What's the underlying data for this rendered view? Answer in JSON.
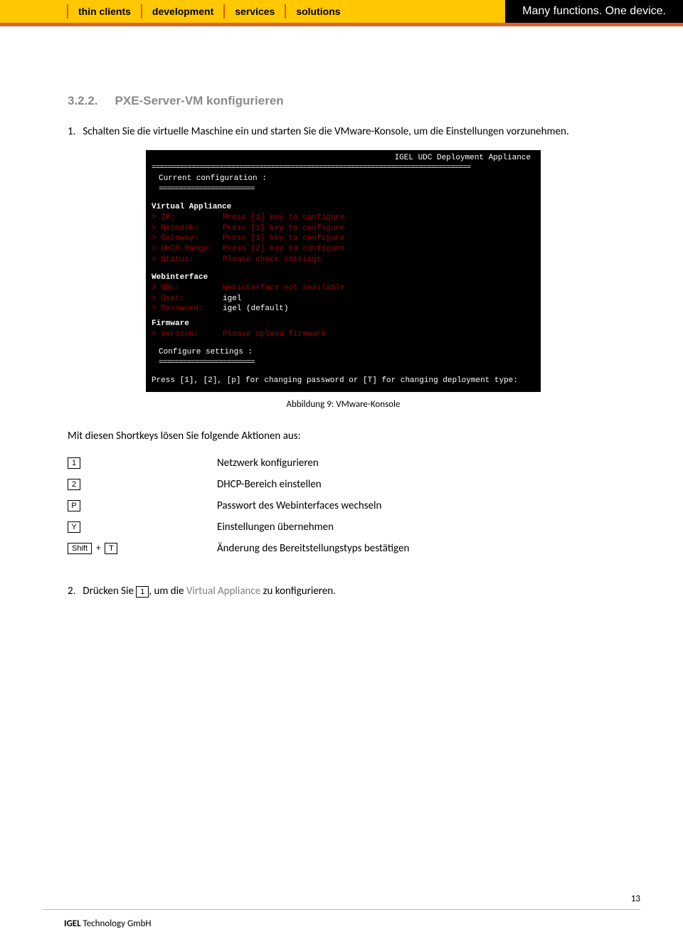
{
  "header": {
    "nav": [
      "thin clients",
      "development",
      "services",
      "solutions"
    ],
    "tagline": "Many functions. One device."
  },
  "section": {
    "number": "3.2.2.",
    "title": "PXE-Server-VM konfigurieren"
  },
  "step1": {
    "num": "1.",
    "text": "Schalten Sie die virtuelle Maschine ein und starten Sie die VMware-Konsole, um die Einstellungen vorzunehmen."
  },
  "terminal": {
    "title": "IGEL UDC Deployment Appliance",
    "current_conf": "Current configuration :",
    "va_header": "Virtual Appliance",
    "rows_va": [
      {
        "label": "> IP:",
        "value": "Press [1] key to configure"
      },
      {
        "label": "> Netmask:",
        "value": "Press [1] key to configure"
      },
      {
        "label": "> Gateway:",
        "value": "Press [1] key to configure"
      },
      {
        "label": "> DHCP-Range:",
        "value": "Press [2] key to configure"
      },
      {
        "label": "> Status:",
        "value": "Please check settings"
      }
    ],
    "wi_header": "Webinterface",
    "rows_wi": [
      {
        "label": "> URL:",
        "value": "Webinterface not available",
        "red": true
      },
      {
        "label": "> User:",
        "value": "igel",
        "red": false
      },
      {
        "label": "> Password:",
        "value": "igel (default)",
        "red": false
      }
    ],
    "fw_header": "Firmware",
    "fw_row": {
      "label": "> Version:",
      "value": "Please upload firmware"
    },
    "conf_settings": "Configure settings :",
    "bottom": "Press [1], [2], [p] for changing password or [T] for changing deployment type:"
  },
  "caption": "Abbildung 9: VMware-Konsole",
  "para_shortkeys": "Mit diesen Shortkeys lösen Sie folgende Aktionen aus:",
  "shortkeys": [
    {
      "keys": [
        "1"
      ],
      "desc": "Netzwerk konfigurieren"
    },
    {
      "keys": [
        "2"
      ],
      "desc": "DHCP-Bereich einstellen"
    },
    {
      "keys": [
        "P"
      ],
      "desc": "Passwort des Webinterfaces wechseln"
    },
    {
      "keys": [
        "Y"
      ],
      "desc": "Einstellungen übernehmen"
    },
    {
      "keys": [
        "Shift",
        "T"
      ],
      "combo": true,
      "desc": "Änderung des Bereitstellungstyps bestätigen"
    }
  ],
  "step2": {
    "num": "2.",
    "pre": "Drücken Sie ",
    "key": "1",
    "mid": ", um die ",
    "link": "Virtual Appliance",
    "post": " zu konfigurieren."
  },
  "footer": {
    "brand_bold": "IGEL",
    "brand_rest": " Technology GmbH"
  },
  "page_number": "13"
}
